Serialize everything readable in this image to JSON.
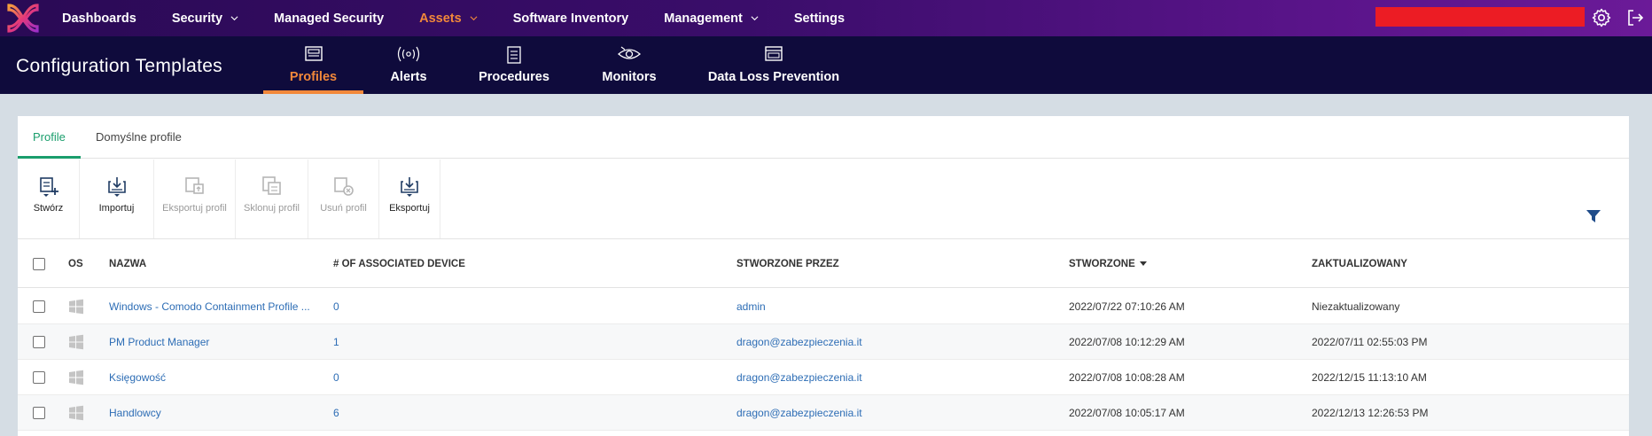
{
  "topnav": {
    "items": [
      {
        "label": "Dashboards",
        "has_dropdown": false,
        "active": false
      },
      {
        "label": "Security",
        "has_dropdown": true,
        "active": false
      },
      {
        "label": "Managed Security",
        "has_dropdown": false,
        "active": false
      },
      {
        "label": "Assets",
        "has_dropdown": true,
        "active": true
      },
      {
        "label": "Software Inventory",
        "has_dropdown": false,
        "active": false
      },
      {
        "label": "Management",
        "has_dropdown": true,
        "active": false
      },
      {
        "label": "Settings",
        "has_dropdown": false,
        "active": false
      }
    ],
    "right_icons": [
      "gear-icon",
      "logout-icon"
    ]
  },
  "subheader": {
    "title": "Configuration Templates",
    "tabs": [
      {
        "label": "Profiles",
        "icon": "profiles-icon",
        "active": true
      },
      {
        "label": "Alerts",
        "icon": "alerts-icon",
        "active": false
      },
      {
        "label": "Procedures",
        "icon": "procedures-icon",
        "active": false
      },
      {
        "label": "Monitors",
        "icon": "monitors-icon",
        "active": false
      },
      {
        "label": "Data Loss Prevention",
        "icon": "dlp-icon",
        "active": false
      }
    ]
  },
  "content": {
    "tabs": [
      {
        "label": "Profile",
        "active": true
      },
      {
        "label": "Domyślne profile",
        "active": false
      }
    ],
    "toolbar": [
      {
        "label": "Stwórz",
        "icon": "create-icon",
        "enabled": true
      },
      {
        "label": "Importuj",
        "icon": "import-icon",
        "enabled": true
      },
      {
        "label": "Eksportuj profil",
        "icon": "export-profile-icon",
        "enabled": false
      },
      {
        "label": "Sklonuj profil",
        "icon": "clone-icon",
        "enabled": false
      },
      {
        "label": "Usuń profil",
        "icon": "delete-icon",
        "enabled": false
      },
      {
        "label": "Eksportuj",
        "icon": "export-icon",
        "enabled": true
      }
    ],
    "table": {
      "columns": [
        "OS",
        "NAZWA",
        "# OF ASSOCIATED DEVICE",
        "STWORZONE PRZEZ",
        "STWORZONE",
        "ZAKTUALIZOWANY"
      ],
      "sorted_column": "STWORZONE",
      "rows": [
        {
          "os": "windows-icon",
          "name": "Windows - Comodo Containment Profile ...",
          "devices": "0",
          "created_by": "admin",
          "created": "2022/07/22 07:10:26 AM",
          "updated": "Niezaktualizowany"
        },
        {
          "os": "windows-icon",
          "name": "PM Product Manager",
          "devices": "1",
          "created_by": "dragon@zabezpieczenia.it",
          "created": "2022/07/08 10:12:29 AM",
          "updated": "2022/07/11 02:55:03 PM"
        },
        {
          "os": "windows-icon",
          "name": "Księgowość",
          "devices": "0",
          "created_by": "dragon@zabezpieczenia.it",
          "created": "2022/07/08 10:08:28 AM",
          "updated": "2022/12/15 11:13:10 AM"
        },
        {
          "os": "windows-icon",
          "name": "Handlowcy",
          "devices": "6",
          "created_by": "dragon@zabezpieczenia.it",
          "created": "2022/07/08 10:05:17 AM",
          "updated": "2022/12/13 12:26:53 PM"
        }
      ]
    }
  },
  "colors": {
    "accent_orange": "#f2883a",
    "accent_green": "#1a9e6c",
    "link_blue": "#2d6db5",
    "subheader_bg": "#0f0b3c",
    "topbar_bg": "#3a0d6a",
    "redaction": "#ec1c24"
  }
}
